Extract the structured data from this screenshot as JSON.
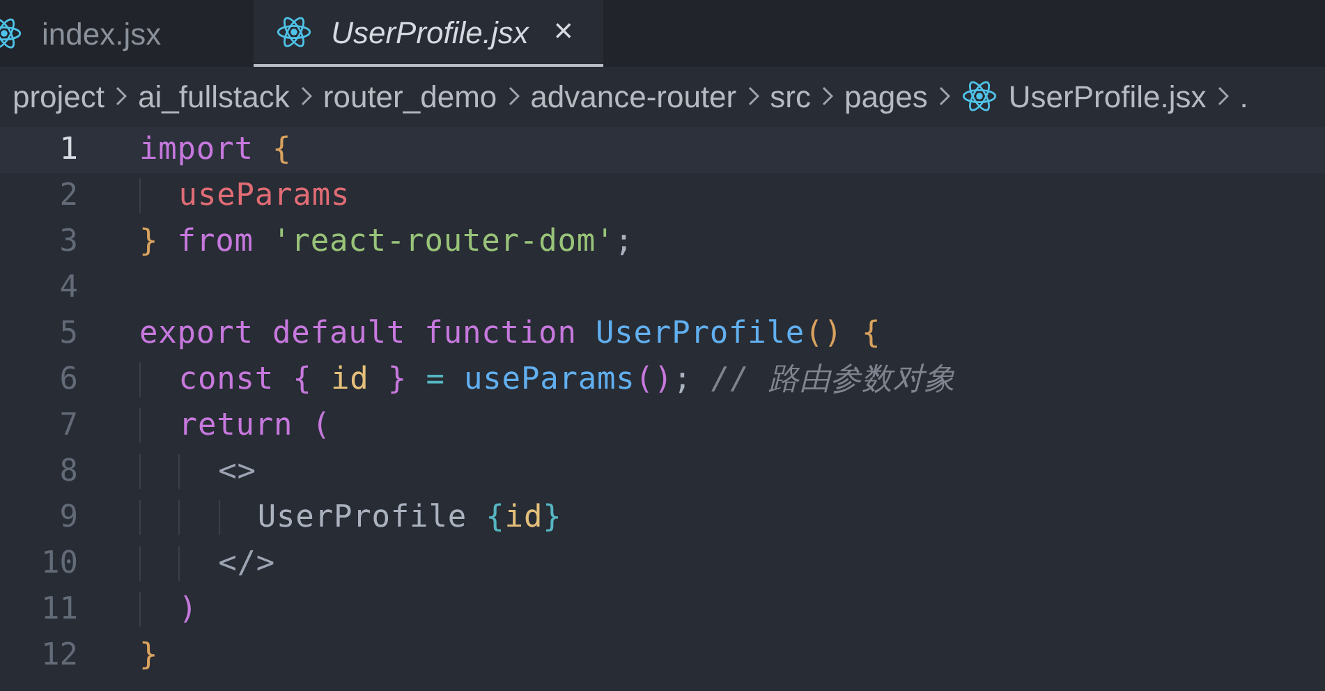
{
  "tabs": [
    {
      "label": "index.jsx",
      "selected": false
    },
    {
      "label": "UserProfile.jsx",
      "selected": true,
      "close": "×"
    }
  ],
  "breadcrumb": [
    {
      "label": "project",
      "kind": "folder"
    },
    {
      "label": "ai_fullstack",
      "kind": "folder"
    },
    {
      "label": "router_demo",
      "kind": "folder"
    },
    {
      "label": "advance-router",
      "kind": "folder"
    },
    {
      "label": "src",
      "kind": "folder"
    },
    {
      "label": "pages",
      "kind": "folder"
    },
    {
      "label": "UserProfile.jsx",
      "kind": "file"
    },
    {
      "label": ".",
      "kind": "folder"
    }
  ],
  "editor": {
    "lines": [
      {
        "number": "1",
        "active": true,
        "tokens": [
          {
            "text": "import ",
            "kind": "keyword"
          },
          {
            "text": "{",
            "kind": "brace1"
          }
        ]
      },
      {
        "number": "2",
        "active": false,
        "tokens": [
          {
            "text": "  useParams",
            "kind": "variable"
          }
        ]
      },
      {
        "number": "3",
        "active": false,
        "tokens": [
          {
            "text": "}",
            "kind": "brace1"
          },
          {
            "text": " from ",
            "kind": "keyword"
          },
          {
            "text": "'react-router-dom'",
            "kind": "string"
          },
          {
            "text": ";",
            "kind": "plain"
          }
        ]
      },
      {
        "number": "4",
        "active": false
      },
      {
        "number": "5",
        "active": false,
        "tokens": [
          {
            "text": "export default function ",
            "kind": "keyword"
          },
          {
            "text": "UserProfile",
            "kind": "function"
          },
          {
            "text": "()",
            "kind": "brace1"
          },
          {
            "text": " {",
            "kind": "brace1"
          }
        ]
      },
      {
        "number": "6",
        "active": false,
        "tokens": [
          {
            "text": "  const ",
            "kind": "keyword"
          },
          {
            "text": "{",
            "kind": "brace2"
          },
          {
            "text": " id ",
            "kind": "constant"
          },
          {
            "text": "}",
            "kind": "brace2"
          },
          {
            "text": " = ",
            "kind": "operator"
          },
          {
            "text": "useParams",
            "kind": "function"
          },
          {
            "text": "()",
            "kind": "brace2"
          },
          {
            "text": "; ",
            "kind": "plain"
          },
          {
            "text": "// 路由参数对象",
            "kind": "comment"
          }
        ]
      },
      {
        "number": "7",
        "active": false,
        "tokens": [
          {
            "text": "  return ",
            "kind": "keyword"
          },
          {
            "text": "(",
            "kind": "brace2"
          }
        ]
      },
      {
        "number": "8",
        "active": false,
        "tokens": [
          {
            "text": "    <>",
            "kind": "tag"
          }
        ]
      },
      {
        "number": "9",
        "active": false,
        "tokens": [
          {
            "text": "      UserProfile ",
            "kind": "plain"
          },
          {
            "text": "{",
            "kind": "brace3"
          },
          {
            "text": "id",
            "kind": "constant"
          },
          {
            "text": "}",
            "kind": "brace3"
          }
        ]
      },
      {
        "number": "10",
        "active": false,
        "tokens": [
          {
            "text": "    </>",
            "kind": "tag"
          }
        ]
      },
      {
        "number": "11",
        "active": false,
        "tokens": [
          {
            "text": "  )",
            "kind": "brace2"
          }
        ]
      },
      {
        "number": "12",
        "active": false,
        "tokens": [
          {
            "text": "}",
            "kind": "brace1"
          }
        ]
      }
    ]
  }
}
